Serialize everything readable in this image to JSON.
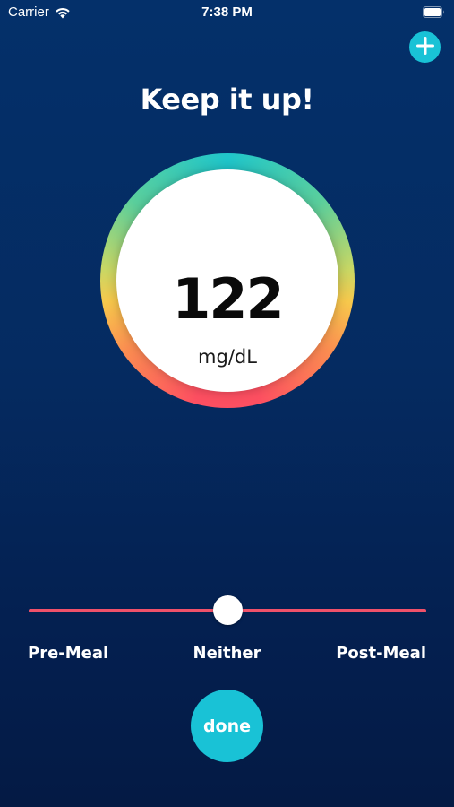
{
  "status_bar": {
    "carrier": "Carrier",
    "time": "7:38 PM",
    "wifi_icon": "wifi-icon",
    "battery_icon": "battery-icon"
  },
  "header": {
    "add_icon": "plus-icon",
    "heading": "Keep it up!"
  },
  "reading": {
    "value": "122",
    "unit": "mg/dL"
  },
  "meal_slider": {
    "options": [
      "Pre-Meal",
      "Neither",
      "Post-Meal"
    ],
    "selected": "Neither",
    "position": 0.5
  },
  "actions": {
    "done_label": "done"
  },
  "colors": {
    "background": "#052b61",
    "accent": "#19c2d6",
    "slider_track": "#f0516a",
    "gauge_gradient": [
      "#1fc6cb",
      "#5bcf9c",
      "#f7c84c",
      "#fb8c51",
      "#fd4f61"
    ]
  }
}
